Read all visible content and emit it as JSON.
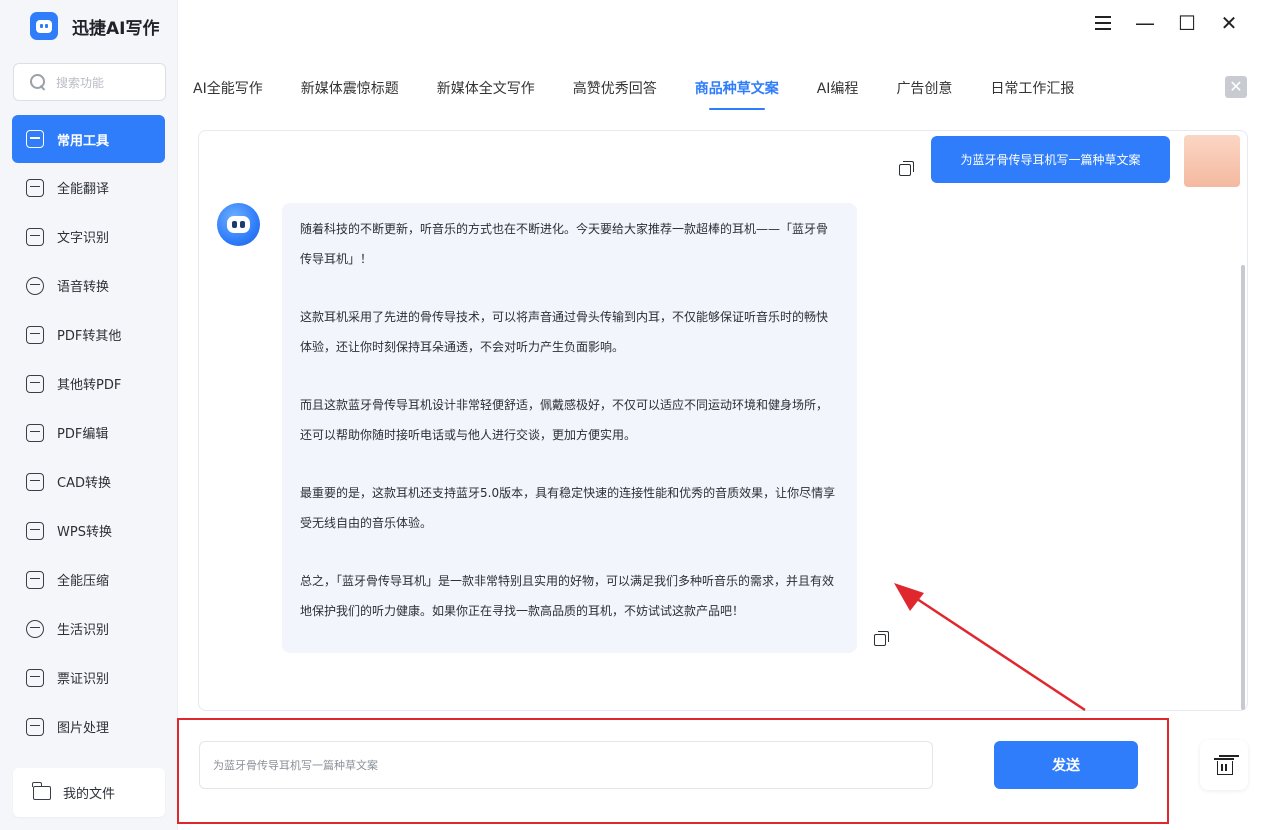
{
  "app": {
    "title": "迅捷AI写作"
  },
  "search": {
    "placeholder": "搜索功能"
  },
  "sidebar": {
    "items": [
      {
        "label": "常用工具",
        "active": true,
        "icon": "toolbox-icon"
      },
      {
        "label": "全能翻译",
        "icon": "translate-icon"
      },
      {
        "label": "文字识别",
        "icon": "text-scan-icon"
      },
      {
        "label": "语音转换",
        "icon": "voice-icon"
      },
      {
        "label": "PDF转其他",
        "icon": "pdf-export-icon"
      },
      {
        "label": "其他转PDF",
        "icon": "pdf-import-icon"
      },
      {
        "label": "PDF编辑",
        "icon": "pdf-edit-icon"
      },
      {
        "label": "CAD转换",
        "icon": "cad-icon"
      },
      {
        "label": "WPS转换",
        "icon": "wps-icon"
      },
      {
        "label": "全能压缩",
        "icon": "compress-icon"
      },
      {
        "label": "生活识别",
        "icon": "eye-scan-icon"
      },
      {
        "label": "票证识别",
        "icon": "id-scan-icon"
      },
      {
        "label": "图片处理",
        "icon": "image-edit-icon"
      }
    ],
    "my_files": "我的文件"
  },
  "tabs": [
    {
      "label": "AI全能写作"
    },
    {
      "label": "新媒体震惊标题"
    },
    {
      "label": "新媒体全文写作"
    },
    {
      "label": "高赞优秀回答"
    },
    {
      "label": "商品种草文案",
      "active": true
    },
    {
      "label": "AI编程"
    },
    {
      "label": "广告创意"
    },
    {
      "label": "日常工作汇报"
    }
  ],
  "chat": {
    "user_message": "为蓝牙骨传导耳机写一篇种草文案",
    "bot_paragraphs": [
      "随着科技的不断更新，听音乐的方式也在不断进化。今天要给大家推荐一款超棒的耳机——「蓝牙骨传导耳机」！",
      "这款耳机采用了先进的骨传导技术，可以将声音通过骨头传输到内耳，不仅能够保证听音乐时的畅快体验，还让你时刻保持耳朵通透，不会对听力产生负面影响。",
      "而且这款蓝牙骨传导耳机设计非常轻便舒适，佩戴感极好，不仅可以适应不同运动环境和健身场所，还可以帮助你随时接听电话或与他人进行交谈，更加方便实用。",
      "最重要的是，这款耳机还支持蓝牙5.0版本，具有稳定快速的连接性能和优秀的音质效果，让你尽情享受无线自由的音乐体验。",
      "总之，「蓝牙骨传导耳机」是一款非常特别且实用的好物，可以满足我们多种听音乐的需求，并且有效地保护我们的听力健康。如果你正在寻找一款高品质的耳机，不妨试试这款产品吧！"
    ]
  },
  "input": {
    "value": "为蓝牙骨传导耳机写一篇种草文案"
  },
  "send_button": "发送",
  "colors": {
    "accent": "#2f7dfa",
    "annotation": "#e0272d"
  }
}
